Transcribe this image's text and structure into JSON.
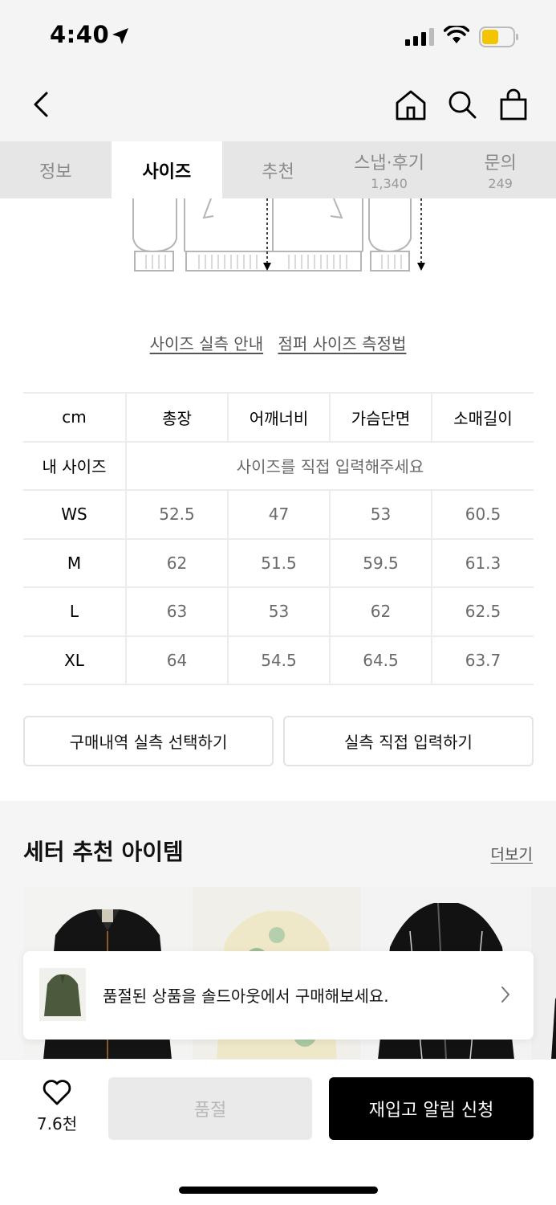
{
  "status_bar": {
    "time": "4:40"
  },
  "tabs": [
    {
      "label": "정보",
      "count": ""
    },
    {
      "label": "사이즈",
      "count": ""
    },
    {
      "label": "추천",
      "count": ""
    },
    {
      "label": "스냅·후기",
      "count": "1,340"
    },
    {
      "label": "문의",
      "count": "249"
    }
  ],
  "active_tab": "사이즈",
  "guide_links": {
    "actual_size_guide": "사이즈 실측 안내",
    "jumper_measure": "점퍼 사이즈 측정법"
  },
  "size_table": {
    "headers": [
      "cm",
      "총장",
      "어깨너비",
      "가슴단면",
      "소매길이"
    ],
    "my_size": {
      "label": "내 사이즈",
      "placeholder": "사이즈를 직접 입력해주세요"
    },
    "rows": [
      {
        "size": "WS",
        "values": [
          "52.5",
          "47",
          "53",
          "60.5"
        ]
      },
      {
        "size": "M",
        "values": [
          "62",
          "51.5",
          "59.5",
          "61.3"
        ]
      },
      {
        "size": "L",
        "values": [
          "63",
          "53",
          "62",
          "62.5"
        ]
      },
      {
        "size": "XL",
        "values": [
          "64",
          "54.5",
          "64.5",
          "63.7"
        ]
      }
    ]
  },
  "buttons": {
    "purchase_history": "구매내역 실측 선택하기",
    "direct_input": "실측 직접 입력하기"
  },
  "recommend": {
    "title": "세터 추천 아이템",
    "more": "더보기"
  },
  "toast": {
    "text": "품절된 상품을 솔드아웃에서 구매해보세요."
  },
  "bottom_bar": {
    "like_count": "7.6천",
    "soldout": "품절",
    "restock": "재입고 알림 신청"
  }
}
